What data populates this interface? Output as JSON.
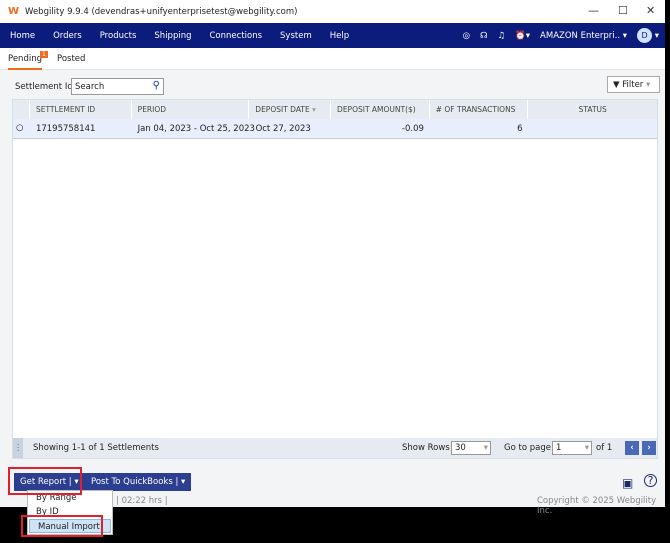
{
  "window": {
    "title": "Webgility 9.9.4 (devendras+unifyenterprisetest@webgility.com)",
    "min": "—",
    "max": "☐",
    "close": "✕"
  },
  "nav": {
    "items": [
      "Home",
      "Orders",
      "Products",
      "Shipping",
      "Connections",
      "System",
      "Help"
    ],
    "store": "AMAZON Enterpri..",
    "avatar": "D"
  },
  "tabs": [
    {
      "label": "Pending",
      "badge": "1"
    },
    {
      "label": "Posted"
    }
  ],
  "toolbar": {
    "label": "Settlement Id",
    "search_placeholder": "Search",
    "filter": "Filter"
  },
  "table": {
    "columns": [
      "SETTLEMENT ID",
      "PERIOD",
      "DEPOSIT DATE",
      "DEPOSIT AMOUNT($)",
      "# OF TRANSACTIONS",
      "STATUS"
    ],
    "rows": [
      {
        "id": "17195758141",
        "period": "Jan 04, 2023 - Oct 25, 2023",
        "date": "Oct 27, 2023",
        "amount": "-0.09",
        "transactions": "6",
        "status": ""
      }
    ]
  },
  "pager": {
    "showing": "Showing 1-1 of 1 Settlements",
    "show_rows_label": "Show Rows",
    "rows": "30",
    "goto_label": "Go to page",
    "page": "1",
    "of": "of 1"
  },
  "actions": {
    "get_report": "Get Report",
    "post": "Post To QuickBooks"
  },
  "menu": [
    "By Range",
    "By ID",
    "Manual Import"
  ],
  "status": {
    "time": "| 02:22 hrs |",
    "copyright": "Copyright © 2025 Webgility Inc."
  }
}
